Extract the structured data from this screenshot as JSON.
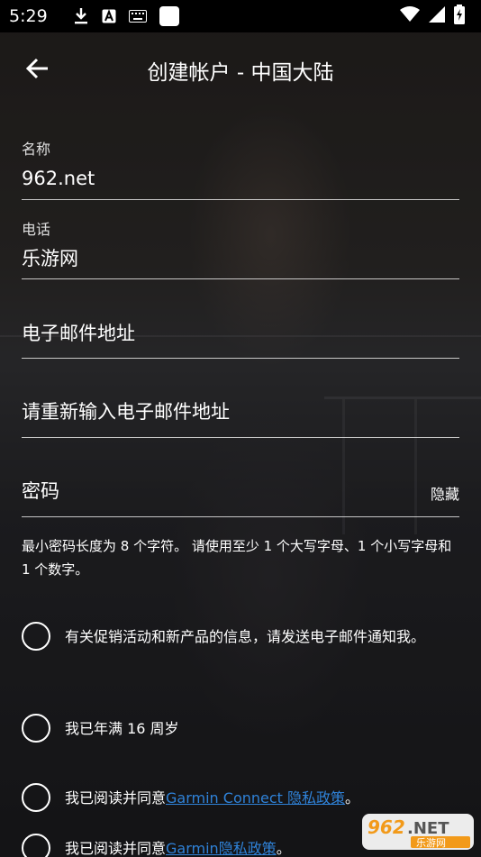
{
  "status_bar": {
    "time": "5:29",
    "icons": [
      "download-icon",
      "text-a-icon",
      "keyboard-icon",
      "white-square-icon"
    ],
    "right_icons": [
      "wifi-icon",
      "signal-icon",
      "battery-charging-icon"
    ]
  },
  "header": {
    "title": "创建帐户 - 中国大陆",
    "back_icon": "arrow-left-icon"
  },
  "form": {
    "name": {
      "label": "名称",
      "value": "962.net"
    },
    "phone": {
      "label": "电话",
      "value": "乐游网"
    },
    "email": {
      "placeholder": "电子邮件地址"
    },
    "email_confirm": {
      "placeholder": "请重新输入电子邮件地址"
    },
    "password": {
      "placeholder": "密码",
      "toggle_label": "隐藏"
    },
    "password_hint": "最小密码长度为 8 个字符。 请使用至少 1 个大写字母、1 个小写字母和 1 个数字。"
  },
  "checks": {
    "promo": "有关促销活动和新产品的信息，请发送电子邮件通知我。",
    "age": "我已年满 16 周岁",
    "connect_prefix": "我已阅读并同意",
    "connect_link": "Garmin Connect 隐私政策",
    "connect_suffix": "。",
    "garmin_prefix": "我已阅读并同意",
    "garmin_link": "Garmin隐私政策",
    "garmin_suffix": "。"
  },
  "watermark": {
    "text_top": "962.NET",
    "text_bottom": "乐游网"
  },
  "colors": {
    "link": "#2f82d8",
    "status_bar": "#000000",
    "text": "#ffffff"
  }
}
